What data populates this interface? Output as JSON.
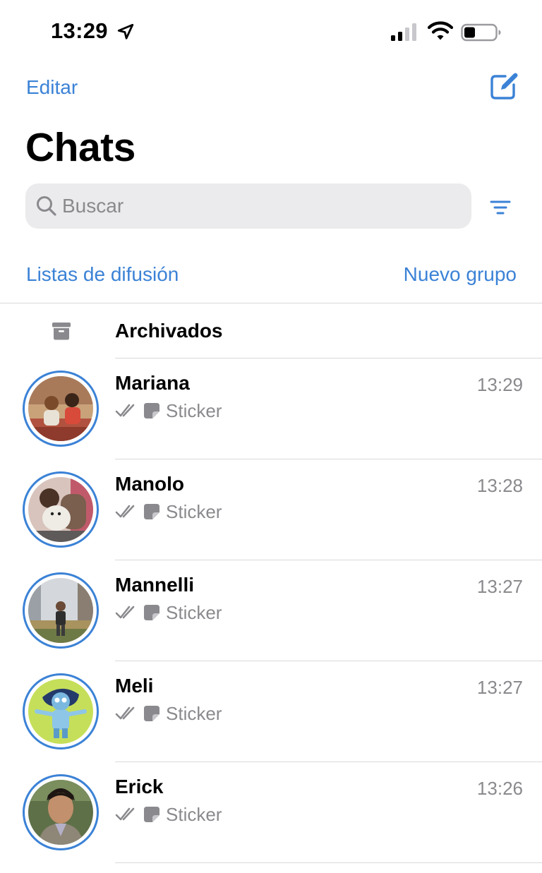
{
  "status_bar": {
    "time": "13:29"
  },
  "nav": {
    "edit_label": "Editar",
    "title": "Chats"
  },
  "search": {
    "placeholder": "Buscar"
  },
  "links": {
    "broadcast_label": "Listas de difusión",
    "new_group_label": "Nuevo grupo"
  },
  "archived": {
    "label": "Archivados"
  },
  "chats": [
    {
      "name": "Mariana",
      "time": "13:29",
      "preview": "Sticker"
    },
    {
      "name": "Manolo",
      "time": "13:28",
      "preview": "Sticker"
    },
    {
      "name": "Mannelli",
      "time": "13:27",
      "preview": "Sticker"
    },
    {
      "name": "Meli",
      "time": "13:27",
      "preview": "Sticker"
    },
    {
      "name": "Erick",
      "time": "13:26",
      "preview": "Sticker"
    }
  ],
  "colors": {
    "accent": "#3b82d6",
    "secondary_text": "#8a8a8e",
    "search_bg": "#ebebed",
    "divider": "#d9d9dc"
  },
  "icons": [
    "location-arrow-icon",
    "signal-icon",
    "wifi-icon",
    "battery-icon",
    "compose-icon",
    "search-icon",
    "filter-icon",
    "archive-icon",
    "double-check-icon",
    "sticker-icon"
  ]
}
